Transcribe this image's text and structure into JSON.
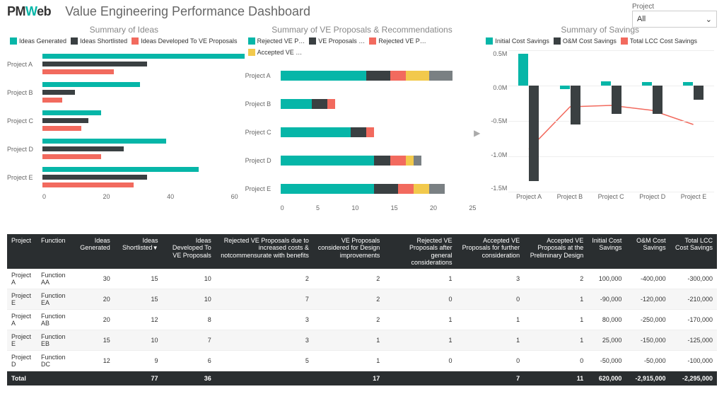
{
  "brand": {
    "pm": "PM",
    "w": "W",
    "eb": "eb"
  },
  "title": "Value Engineering Performance Dashboard",
  "filter": {
    "label": "Project",
    "value": "All",
    "chevron": "⌄"
  },
  "chart_data": [
    {
      "id": "ideas",
      "type": "bar",
      "orientation": "horizontal",
      "title": "Summary of Ideas",
      "categories": [
        "Project A",
        "Project B",
        "Project C",
        "Project D",
        "Project E"
      ],
      "series": [
        {
          "name": "Ideas Generated",
          "color": "#06b6a8",
          "values": [
            62,
            30,
            18,
            38,
            48
          ]
        },
        {
          "name": "Ideas Shortlisted",
          "color": "#3a4042",
          "values": [
            32,
            10,
            14,
            25,
            32
          ]
        },
        {
          "name": "Ideas Developed To VE Proposals",
          "color": "#f26a5e",
          "values": [
            22,
            6,
            12,
            18,
            28
          ]
        }
      ],
      "xlim": [
        0,
        60
      ],
      "xticks": [
        0,
        20,
        40,
        60
      ]
    },
    {
      "id": "proposals",
      "type": "bar",
      "stacked": true,
      "orientation": "horizontal",
      "title": "Summary of VE Proposals & Recommendations",
      "categories": [
        "Project A",
        "Project B",
        "Project C",
        "Project D",
        "Project E"
      ],
      "series": [
        {
          "name": "Rejected VE P…",
          "color": "#06b6a8",
          "values": [
            11,
            4,
            9,
            12,
            12
          ]
        },
        {
          "name": "VE Proposals …",
          "color": "#3a4042",
          "values": [
            3,
            2,
            2,
            2,
            3
          ]
        },
        {
          "name": "Rejected VE P…",
          "color": "#f26a5e",
          "values": [
            2,
            1,
            1,
            2,
            2
          ]
        },
        {
          "name": "Accepted VE …",
          "color": "#f2c94c",
          "values": [
            3,
            0,
            0,
            1,
            2
          ]
        },
        {
          "name": "",
          "color": "#7a8083",
          "values": [
            3,
            0,
            0,
            1,
            2
          ]
        }
      ],
      "xlim": [
        0,
        25
      ],
      "xticks": [
        0,
        5,
        10,
        15,
        20,
        25
      ]
    },
    {
      "id": "savings",
      "type": "combo",
      "title": "Summary of Savings",
      "categories": [
        "Project A",
        "Project B",
        "Project C",
        "Project D",
        "Project E"
      ],
      "series": [
        {
          "name": "Initial Cost Savings",
          "kind": "column",
          "color": "#06b6a8",
          "values": [
            0.45,
            -0.05,
            0.06,
            0.05,
            0.05
          ]
        },
        {
          "name": "O&M Cost Savings",
          "kind": "column",
          "color": "#3a4042",
          "values": [
            -1.35,
            -0.55,
            -0.4,
            -0.4,
            -0.2
          ]
        },
        {
          "name": "Total LCC Cost Savings",
          "kind": "line",
          "color": "#f26a5e",
          "values": [
            -0.9,
            -0.3,
            -0.28,
            -0.35,
            -0.55
          ]
        }
      ],
      "ylim": [
        -1.5,
        0.5
      ],
      "yticks": [
        "0.5M",
        "0.0M",
        "-0.5M",
        "-1.0M",
        "-1.5M"
      ]
    }
  ],
  "table": {
    "columns": [
      "Project",
      "Function",
      "Ideas Generated",
      "Ideas Shortlisted",
      "Ideas Developed To VE Proposals",
      "Rejected VE Proposals due to increased costs & notcommensurate with benefits",
      "VE Proposals considered for Design improvements",
      "Rejected VE Proposals after general considerations",
      "Accepted VE Proposals for further consideration",
      "Accepted VE Proposals at the Preliminary Design",
      "Initial Cost Savings",
      "O&M Cost Savings",
      "Total LCC Cost Savings"
    ],
    "sort_indicator": "▼",
    "rows": [
      [
        "Project A",
        "Function AA",
        "30",
        "15",
        "10",
        "2",
        "2",
        "1",
        "3",
        "2",
        "100,000",
        "-400,000",
        "-300,000"
      ],
      [
        "Project E",
        "Function EA",
        "20",
        "15",
        "10",
        "7",
        "2",
        "0",
        "0",
        "1",
        "-90,000",
        "-120,000",
        "-210,000"
      ],
      [
        "Project A",
        "Function AB",
        "20",
        "12",
        "8",
        "3",
        "2",
        "1",
        "1",
        "1",
        "80,000",
        "-250,000",
        "-170,000"
      ],
      [
        "Project E",
        "Function EB",
        "15",
        "10",
        "7",
        "3",
        "1",
        "1",
        "1",
        "1",
        "25,000",
        "-150,000",
        "-125,000"
      ],
      [
        "Project D",
        "Function DC",
        "12",
        "9",
        "6",
        "5",
        "1",
        "0",
        "0",
        "0",
        "-50,000",
        "-50,000",
        "-100,000"
      ]
    ],
    "total": [
      "Total",
      "",
      "",
      "77",
      "36",
      "",
      "17",
      "",
      "7",
      "11",
      "620,000",
      "-2,915,000",
      "-2,295,000"
    ]
  }
}
